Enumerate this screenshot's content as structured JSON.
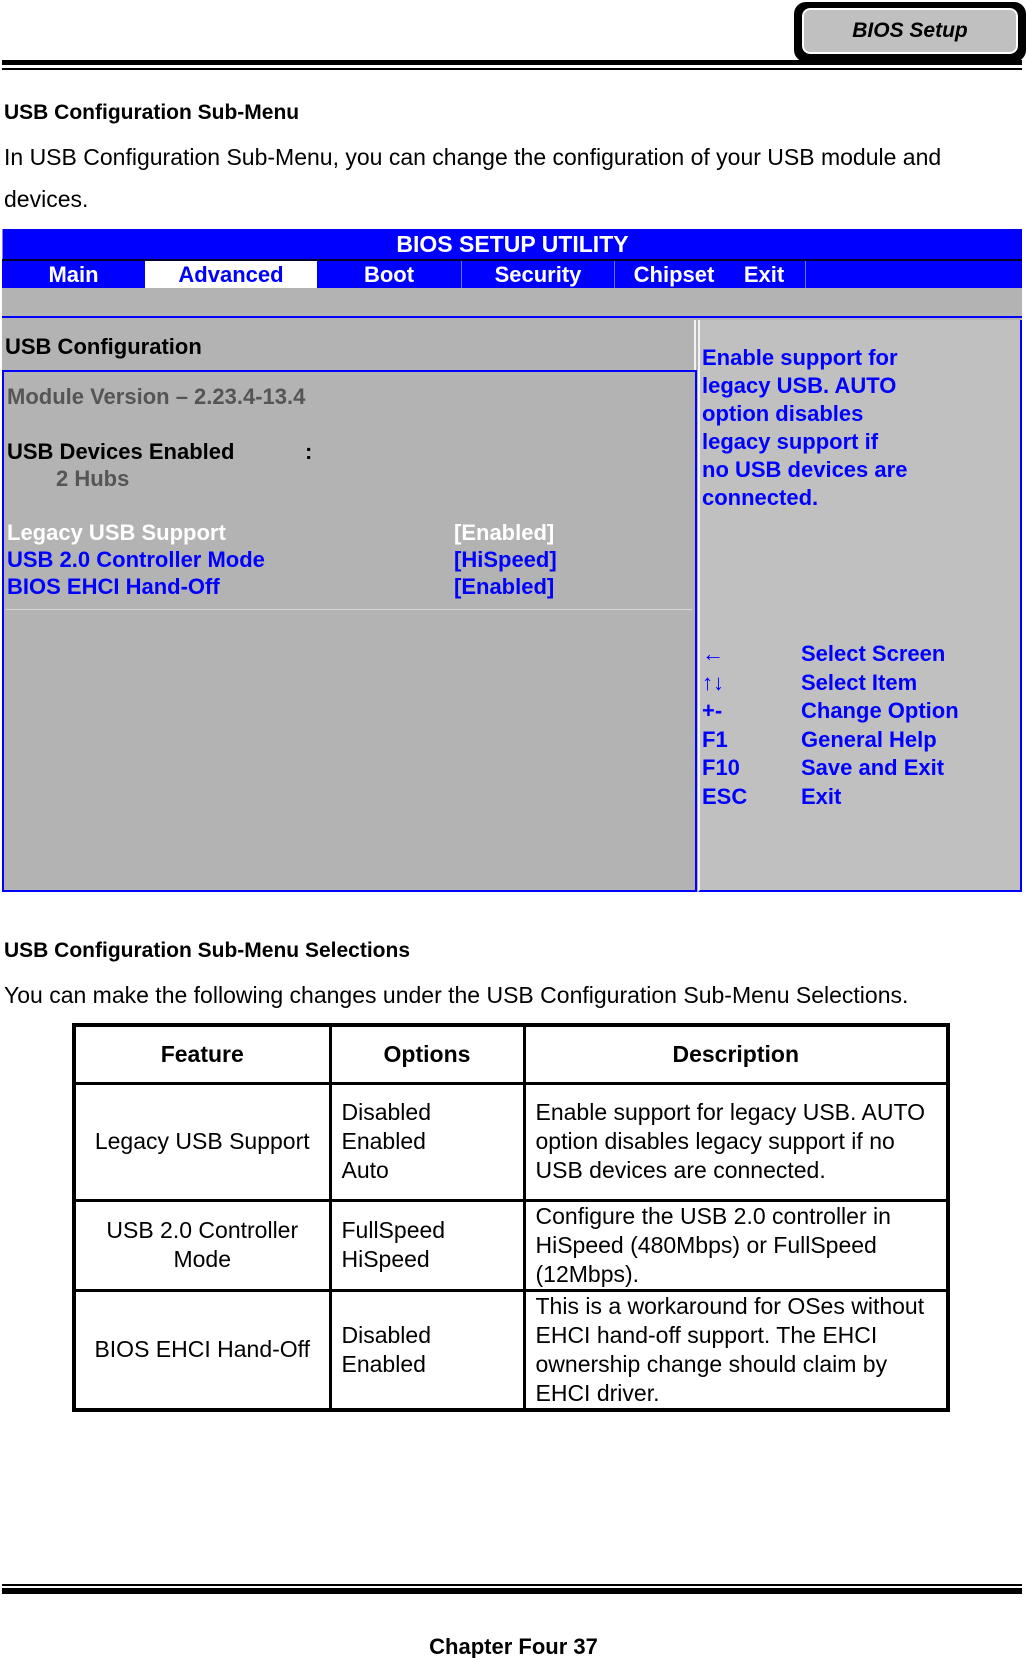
{
  "header": {
    "badge_label": "BIOS Setup"
  },
  "intro": {
    "heading": "USB Configuration Sub-Menu",
    "paragraph": "In USB Configuration Sub-Menu, you can change the configuration of your USB module and devices."
  },
  "bios": {
    "title": "BIOS SETUP UTILITY",
    "tabs": [
      {
        "label": "Main",
        "active": false
      },
      {
        "label": "Advanced",
        "active": true
      },
      {
        "label": "Boot",
        "active": false
      },
      {
        "label": "Security",
        "active": false
      },
      {
        "label": "Chipset",
        "active": false
      },
      {
        "label": "Exit",
        "active": false
      }
    ],
    "section_title": "USB Configuration",
    "module_version": "Module Version – 2.23.4-13.4",
    "usb_devices_label": "USB Devices Enabled",
    "usb_devices_colon": ":",
    "usb_devices_value": "2 Hubs",
    "settings": [
      {
        "label": "Legacy USB Support",
        "value": "[Enabled]",
        "selected": true
      },
      {
        "label": "USB 2.0 Controller Mode",
        "value": "[HiSpeed]",
        "selected": false
      },
      {
        "label": "BIOS EHCI Hand-Off",
        "value": "[Enabled]",
        "selected": false
      }
    ],
    "help_lines": [
      "Enable support for",
      "legacy USB. AUTO",
      "option disables",
      "legacy support if",
      "no USB devices are",
      "connected."
    ],
    "keys": [
      {
        "key": "←",
        "action": "Select Screen",
        "icon": "arrow-left-icon"
      },
      {
        "key": "↑↓",
        "action": "Select Item",
        "icon": "arrow-up-down-icon"
      },
      {
        "key": "+-",
        "action": "Change Option"
      },
      {
        "key": "F1",
        "action": "General Help"
      },
      {
        "key": "F10",
        "action": "Save and Exit"
      },
      {
        "key": "ESC",
        "action": "Exit"
      }
    ],
    "colors": {
      "blue": "#0000ff",
      "panel_grey": "#b3b3b3",
      "help_grey": "#c0c0c0"
    }
  },
  "selections": {
    "heading": "USB Configuration Sub-Menu Selections",
    "paragraph": "You can make the following changes under the USB Configuration Sub-Menu Selections."
  },
  "table": {
    "headers": [
      "Feature",
      "Options",
      "Description"
    ],
    "rows": [
      {
        "feature": "Legacy USB Support",
        "options": [
          "Disabled",
          "Enabled",
          "Auto"
        ],
        "description": "Enable support for legacy USB. AUTO option disables legacy support if no USB devices are connected."
      },
      {
        "feature": "USB 2.0 Controller Mode",
        "options": [
          "FullSpeed",
          "HiSpeed"
        ],
        "description": "Configure the USB 2.0 controller in HiSpeed (480Mbps) or FullSpeed (12Mbps)."
      },
      {
        "feature": "BIOS EHCI Hand-Off",
        "options": [
          "Disabled",
          "Enabled"
        ],
        "description": "This is a workaround for OSes without EHCI hand-off support. The EHCI ownership change should claim by EHCI driver."
      }
    ]
  },
  "footer": {
    "page_label": "Chapter Four 37"
  }
}
